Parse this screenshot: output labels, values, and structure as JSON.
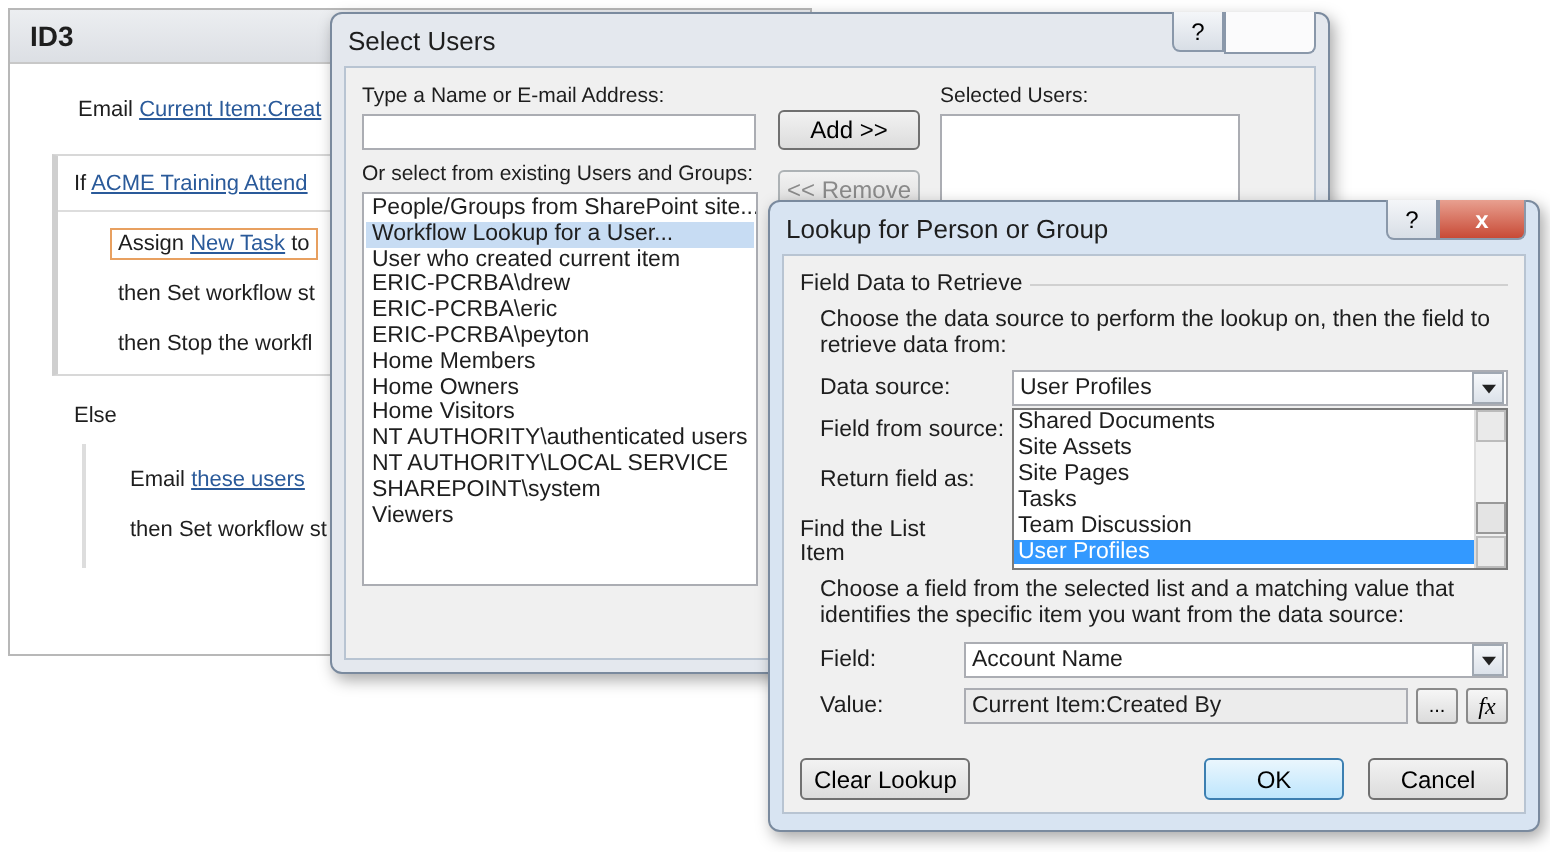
{
  "workflow": {
    "title": "ID3",
    "blocks": [
      {
        "kind": "step",
        "selected": false,
        "segments": [
          {
            "text": "Email ",
            "link": false
          },
          {
            "text": "Current Item:Creat",
            "link": true
          }
        ]
      },
      {
        "kind": "if",
        "segments": [
          {
            "text": "If ",
            "link": false
          },
          {
            "text": "ACME Training Attend",
            "link": true
          }
        ],
        "children": [
          {
            "kind": "step",
            "selected": true,
            "segments": [
              {
                "text": "Assign ",
                "link": false
              },
              {
                "text": "New Task",
                "link": true
              },
              {
                "text": " to",
                "link": false
              }
            ]
          },
          {
            "kind": "step",
            "selected": false,
            "segments": [
              {
                "text": "then Set workflow st",
                "link": false
              }
            ]
          },
          {
            "kind": "step",
            "selected": false,
            "segments": [
              {
                "text": "then Stop the workfl",
                "link": false
              }
            ]
          }
        ]
      },
      {
        "kind": "else",
        "segments": [
          {
            "text": "Else",
            "link": false
          }
        ],
        "children": [
          {
            "kind": "step",
            "selected": false,
            "segments": [
              {
                "text": "Email ",
                "link": false
              },
              {
                "text": "these users",
                "link": true
              }
            ]
          },
          {
            "kind": "step",
            "selected": false,
            "segments": [
              {
                "text": "then Set workflow st",
                "link": false
              }
            ]
          }
        ]
      }
    ]
  },
  "select_users": {
    "title": "Select Users",
    "help": "?",
    "name_label": "Type a Name or E-mail Address:",
    "add_button": "Add >>",
    "remove_button": {
      "label": "<< Remove",
      "disabled": true
    },
    "selected_label": "Selected Users:",
    "groups_label": "Or select from existing Users and Groups:",
    "groups": [
      {
        "label": "People/Groups from SharePoint site...",
        "selected": false
      },
      {
        "label": "Workflow Lookup for a User...",
        "selected": true
      },
      {
        "label": "User who created current item",
        "selected": false
      },
      {
        "label": "ERIC-PCRBA\\drew",
        "selected": false
      },
      {
        "label": "ERIC-PCRBA\\eric",
        "selected": false
      },
      {
        "label": "ERIC-PCRBA\\peyton",
        "selected": false
      },
      {
        "label": "Home Members",
        "selected": false
      },
      {
        "label": "Home Owners",
        "selected": false
      },
      {
        "label": "Home Visitors",
        "selected": false
      },
      {
        "label": "NT AUTHORITY\\authenticated users",
        "selected": false
      },
      {
        "label": "NT AUTHORITY\\LOCAL SERVICE",
        "selected": false
      },
      {
        "label": "SHAREPOINT\\system",
        "selected": false
      },
      {
        "label": "Viewers",
        "selected": false
      }
    ]
  },
  "lookup": {
    "title": "Lookup for Person or Group",
    "help": "?",
    "close": "x",
    "retrieve": {
      "legend": "Field Data to Retrieve",
      "description": "Choose the data source to perform the lookup on, then the field to retrieve data from:",
      "data_source_label": "Data source:",
      "data_source_value": "User Profiles",
      "field_from_source_label": "Field from source:",
      "return_field_label": "Return field as:",
      "dropdown_options": [
        {
          "label": "Shared Documents",
          "selected": false
        },
        {
          "label": "Site Assets",
          "selected": false
        },
        {
          "label": "Site Pages",
          "selected": false
        },
        {
          "label": "Tasks",
          "selected": false
        },
        {
          "label": "Team Discussion",
          "selected": false
        },
        {
          "label": "User Profiles",
          "selected": true
        }
      ]
    },
    "find": {
      "legend": "Find the List Item",
      "description": "Choose a field from the selected list and a matching value that identifies the specific item you want from the data source:",
      "field_label": "Field:",
      "field_value": "Account Name",
      "value_label": "Value:",
      "value_value": "Current Item:Created By",
      "browse_button": "...",
      "formula_button": "fx"
    },
    "buttons": [
      {
        "label": "Clear Lookup",
        "kind": "left",
        "focused": false
      },
      {
        "label": "OK",
        "kind": "right",
        "focused": true
      },
      {
        "label": "Cancel",
        "kind": "right",
        "focused": false
      }
    ]
  }
}
